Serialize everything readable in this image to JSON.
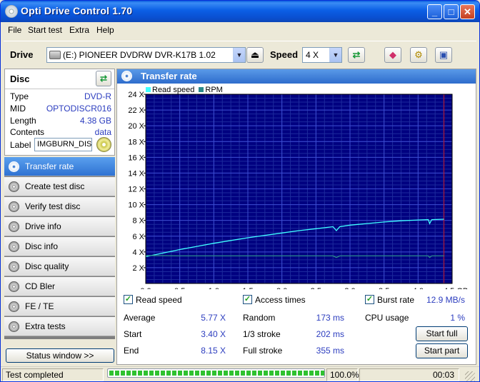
{
  "window": {
    "title": "Opti Drive Control 1.70"
  },
  "menu": [
    "File",
    "Start test",
    "Extra",
    "Help"
  ],
  "toolbar": {
    "drive_label": "Drive",
    "drive_value": "(E:)  PIONEER DVDRW  DVR-K17B 1.02",
    "speed_label": "Speed",
    "speed_value": "4 X"
  },
  "disc": {
    "header": "Disc",
    "rows": [
      {
        "key": "Type",
        "value": "DVD-R"
      },
      {
        "key": "MID",
        "value": "OPTODISCR016"
      },
      {
        "key": "Length",
        "value": "4.38 GB"
      },
      {
        "key": "Contents",
        "value": "data"
      }
    ],
    "label_key": "Label",
    "label_value": "IMGBURN_DIS"
  },
  "nav": [
    {
      "label": "Transfer rate",
      "active": true
    },
    {
      "label": "Create test disc"
    },
    {
      "label": "Verify test disc"
    },
    {
      "label": "Drive info"
    },
    {
      "label": "Disc info"
    },
    {
      "label": "Disc quality"
    },
    {
      "label": "CD Bler"
    },
    {
      "label": "FE / TE"
    },
    {
      "label": "Extra tests"
    }
  ],
  "status_window_button": "Status window >>",
  "panel_title": "Transfer rate",
  "chart_data": {
    "type": "line",
    "legend": [
      {
        "name": "Read speed",
        "color": "#40ffff"
      },
      {
        "name": "RPM",
        "color": "#2b8a8a"
      }
    ],
    "x_ticks": [
      "0.0",
      "0.5",
      "1.0",
      "1.5",
      "2.0",
      "2.5",
      "3.0",
      "3.5",
      "4.0",
      "4.5 GB"
    ],
    "y_ticks": [
      "2 X",
      "4 X",
      "6 X",
      "8 X",
      "10 X",
      "12 X",
      "14 X",
      "16 X",
      "18 X",
      "20 X",
      "22 X",
      "24 X"
    ],
    "xlim": [
      0,
      4.5
    ],
    "ylim": [
      0,
      24
    ],
    "grid": true,
    "end_marker_gb": 4.38,
    "series": [
      {
        "name": "Read speed",
        "x": [
          0.0,
          0.25,
          0.5,
          0.75,
          1.0,
          1.25,
          1.5,
          1.75,
          2.0,
          2.25,
          2.5,
          2.75,
          2.8,
          2.85,
          3.0,
          3.25,
          3.5,
          3.75,
          4.0,
          4.15,
          4.17,
          4.2,
          4.38
        ],
        "y": [
          3.4,
          3.85,
          4.3,
          4.7,
          5.1,
          5.45,
          5.8,
          6.1,
          6.4,
          6.7,
          6.95,
          7.2,
          6.7,
          7.2,
          7.4,
          7.6,
          7.8,
          7.95,
          8.05,
          8.1,
          7.6,
          8.1,
          8.15
        ]
      },
      {
        "name": "RPM",
        "x": [
          0.0,
          0.5,
          1.0,
          1.5,
          2.0,
          2.5,
          2.75,
          2.8,
          2.85,
          3.0,
          3.5,
          4.0,
          4.15,
          4.17,
          4.2,
          4.38
        ],
        "y": [
          3.55,
          3.5,
          3.5,
          3.5,
          3.5,
          3.5,
          3.5,
          3.3,
          3.5,
          3.5,
          3.5,
          3.5,
          3.5,
          3.3,
          3.5,
          3.5
        ]
      }
    ]
  },
  "stats": {
    "read_speed_label": "Read speed",
    "access_times_label": "Access times",
    "burst_rate_label": "Burst rate",
    "burst_rate_value": "12.9 MB/s",
    "average_label": "Average",
    "average_value": "5.77 X",
    "start_label": "Start",
    "start_value": "3.40 X",
    "end_label": "End",
    "end_value": "8.15 X",
    "random_label": "Random",
    "random_value": "173 ms",
    "third_label": "1/3 stroke",
    "third_value": "202 ms",
    "full_label": "Full stroke",
    "full_value": "355 ms",
    "cpu_label": "CPU usage",
    "cpu_value": "1 %",
    "start_full_button": "Start full",
    "start_part_button": "Start part"
  },
  "statusbar": {
    "status_text": "Test completed",
    "progress_fraction": 1.0,
    "progress_text": "100.0%",
    "time_text": "00:03"
  }
}
